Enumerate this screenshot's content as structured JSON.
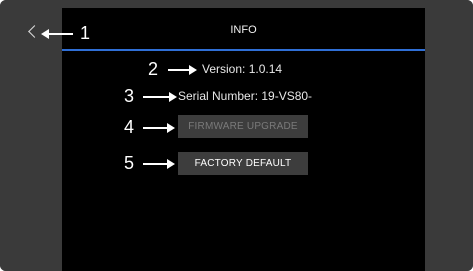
{
  "window": {
    "title": "INFO"
  },
  "info": {
    "version_label": "Version: 1.0.14",
    "serial_label": "Serial Number: 19-VS80-"
  },
  "buttons": {
    "firmware_upgrade": "FIRMWARE UPGRADE",
    "factory_default": "FACTORY DEFAULT"
  },
  "callouts": [
    "1",
    "2",
    "3",
    "4",
    "5"
  ],
  "colors": {
    "accent_line": "#2f6fd6",
    "screen_bg": "#000000",
    "bezel": "#3a3a3a"
  },
  "icons": {
    "back": "chevron-left-icon"
  }
}
